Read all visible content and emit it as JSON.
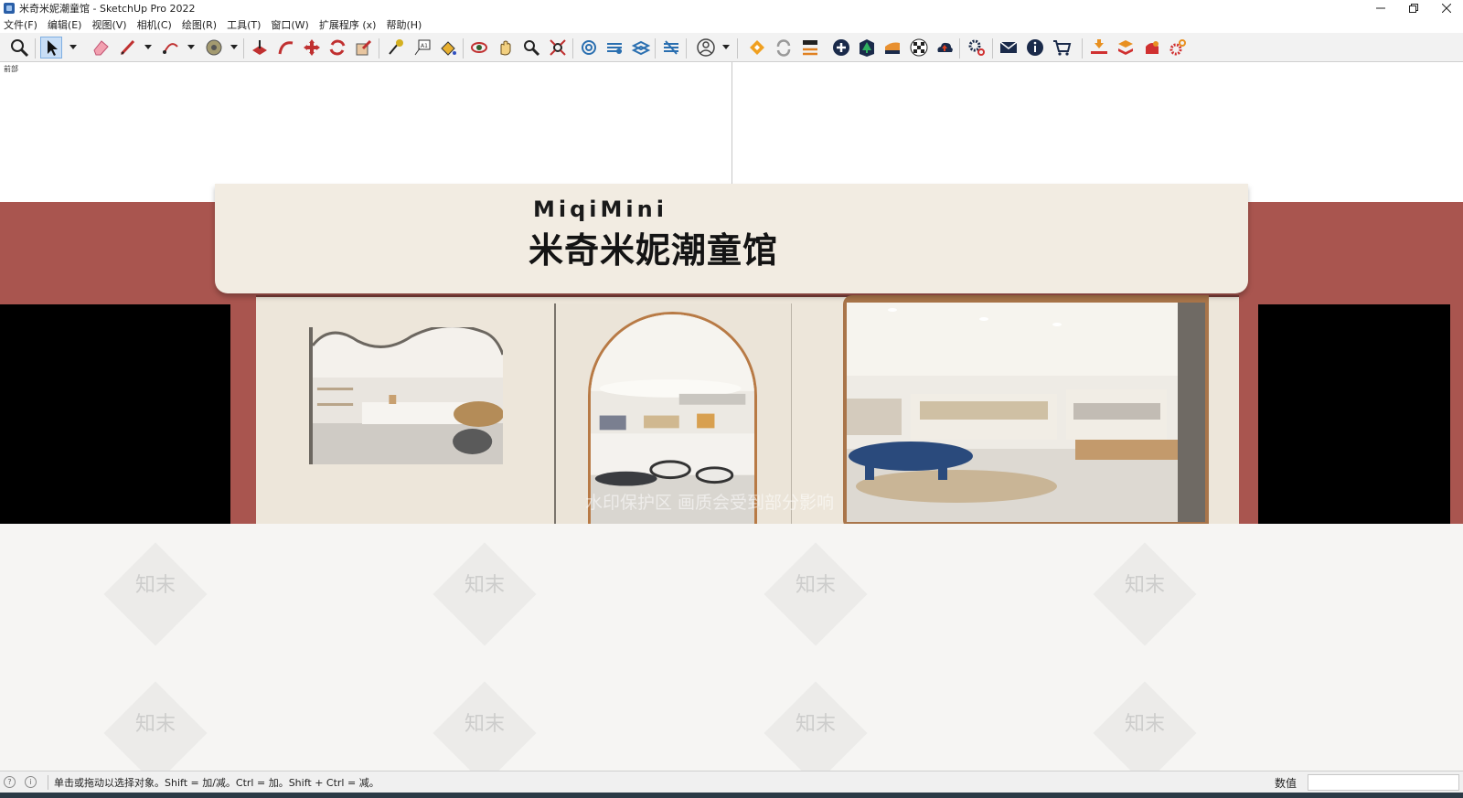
{
  "window": {
    "title": "米奇米妮潮童馆 - SketchUp Pro 2022",
    "controls": [
      "minimize",
      "restore",
      "close"
    ]
  },
  "menu": [
    "文件(F)",
    "编辑(E)",
    "视图(V)",
    "相机(C)",
    "绘图(R)",
    "工具(T)",
    "窗口(W)",
    "扩展程序 (x)",
    "帮助(H)"
  ],
  "toolbar": {
    "active_tool": "select",
    "icons": [
      "zoom-icon",
      "select-icon",
      "eraser-icon",
      "pencil-icon",
      "arc-icon",
      "tape-icon",
      "pushpull-icon",
      "followme-icon",
      "move-icon",
      "rotate-icon",
      "scale-icon",
      "paint-icon",
      "text-icon",
      "paint-bucket-icon",
      "orbit-icon",
      "pan-icon",
      "zoom-window-icon",
      "zoom-extents-icon",
      "style-icon",
      "layers-icon",
      "layers2-icon",
      "component-icon",
      "account-icon",
      "extension-logo-icon",
      "refresh-icon",
      "swap-icon",
      "add-icon",
      "tree-icon",
      "chart-icon",
      "checker-icon",
      "cloud-icon",
      "settings-icon",
      "mail-icon",
      "info-icon",
      "cart-icon",
      "import-icon",
      "stack-icon",
      "puzzle-icon",
      "gear-red-icon"
    ]
  },
  "viewport": {
    "scene_tab": "前部",
    "sign_en": "MiqiMini",
    "sign_cn": "米奇米妮潮童馆",
    "watermark_band": "水印保护区   画质会受到部分影响",
    "watermark_logo": "知末",
    "colors": {
      "wall": "#a9554f",
      "sign": "#f2ece2",
      "front": "#ede6da",
      "wood": "#b87a45"
    }
  },
  "statusbar": {
    "hint": "单击或拖动以选择对象。Shift = 加/减。Ctrl = 加。Shift + Ctrl = 减。",
    "value_label": "数值",
    "value": ""
  }
}
